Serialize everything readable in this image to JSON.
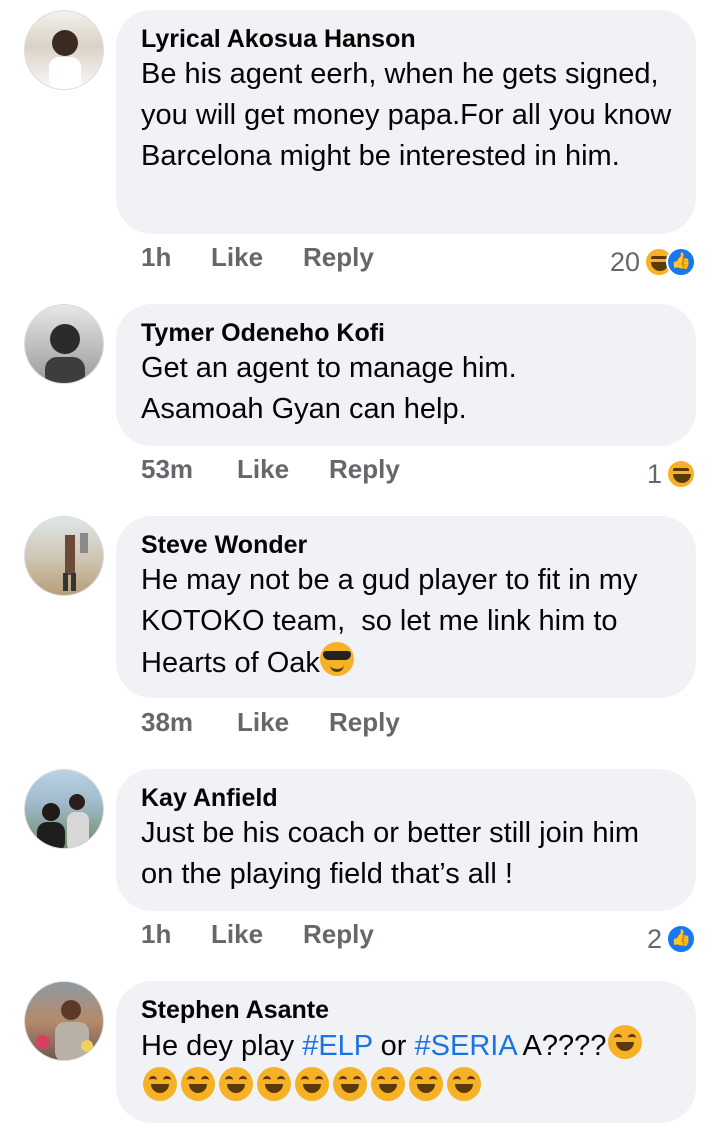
{
  "comments": [
    {
      "author": "Lyrical Akosua Hanson",
      "text": "Be his agent eerh, when he gets signed, you will get money papa.For all you know Barcelona might be interested in him.",
      "time": "1h",
      "like_label": "Like",
      "reply_label": "Reply",
      "reaction_count": "20",
      "reactions": [
        "haha-icon",
        "like-icon"
      ]
    },
    {
      "author": "Tymer Odeneho Kofi",
      "text": "Get an agent to manage him. Asamoah Gyan can help.",
      "time": "53m",
      "like_label": "Like",
      "reply_label": "Reply",
      "reaction_count": "1",
      "reactions": [
        "haha-icon"
      ]
    },
    {
      "author": "Steve Wonder",
      "text": "He may not be a gud player to fit in my KOTOKO team,  so let me link him to Hearts of Oak",
      "time": "38m",
      "like_label": "Like",
      "reply_label": "Reply",
      "reactions": []
    },
    {
      "author": "Kay Anfield",
      "text": "Just be his coach or better still join him on the playing field that’s all !",
      "time": "1h",
      "like_label": "Like",
      "reply_label": "Reply",
      "reaction_count": "2",
      "reactions": [
        "like-icon"
      ]
    },
    {
      "author": "Stephen Asante",
      "text_before": "He dey play ",
      "hashtag1": "#ELP",
      "text_middle": " or ",
      "hashtag2": "#SERIA",
      "text_after": " A????",
      "time": "",
      "reactions": []
    }
  ],
  "colors": {
    "bubble": "#f0f2f5",
    "meta": "#65676b",
    "hashtag": "#1b74e4",
    "like_blue": "#1877f2",
    "emoji_yellow": "#f7b125"
  }
}
